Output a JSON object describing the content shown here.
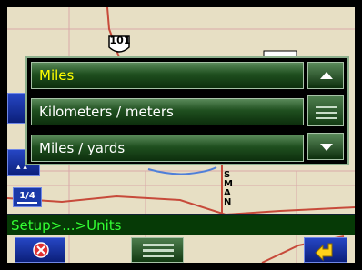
{
  "popup": {
    "items": [
      {
        "label": "Miles",
        "selected": true
      },
      {
        "label": "Kilometers / meters",
        "selected": false
      },
      {
        "label": "Miles / yards",
        "selected": false
      }
    ]
  },
  "map": {
    "highway_shield": "101",
    "street_label": "SMAN"
  },
  "scale": {
    "label": "1/4"
  },
  "status": {
    "breadcrumb": "Setup>...>Units"
  },
  "icons": {
    "cancel": "cancel-icon",
    "menu": "menu-icon",
    "back": "back-icon",
    "scroll_up": "triangle-up-icon",
    "scroll_down": "triangle-down-icon"
  },
  "colors": {
    "selected_text": "#ffff00",
    "status_text": "#33ff33",
    "button_blue": "#1a3aa8",
    "list_green": "#1f4f1f"
  }
}
